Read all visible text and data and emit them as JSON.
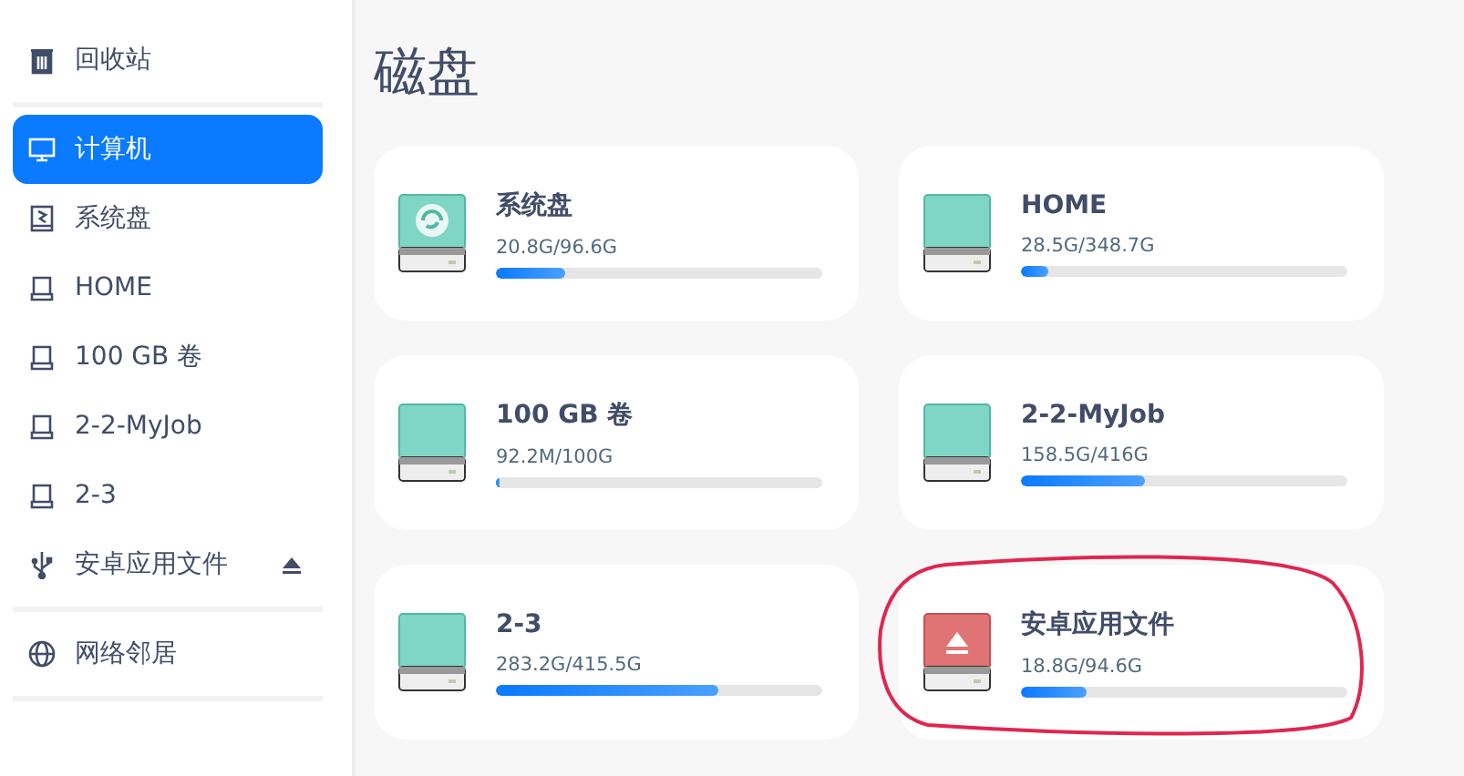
{
  "sidebar": {
    "groups": [
      {
        "items": [
          {
            "kind": "trash",
            "label": "回收站",
            "selected": false,
            "ejectable": false
          }
        ]
      },
      {
        "items": [
          {
            "kind": "computer",
            "label": "计算机",
            "selected": true,
            "ejectable": false
          },
          {
            "kind": "system",
            "label": "系统盘",
            "selected": false,
            "ejectable": false
          },
          {
            "kind": "drive",
            "label": "HOME",
            "selected": false,
            "ejectable": false
          },
          {
            "kind": "drive",
            "label": "100 GB 卷",
            "selected": false,
            "ejectable": false
          },
          {
            "kind": "drive",
            "label": "2-2-MyJob",
            "selected": false,
            "ejectable": false
          },
          {
            "kind": "drive",
            "label": "2-3",
            "selected": false,
            "ejectable": false
          },
          {
            "kind": "usb",
            "label": "安卓应用文件",
            "selected": false,
            "ejectable": true
          }
        ]
      },
      {
        "items": [
          {
            "kind": "network",
            "label": "网络邻居",
            "selected": false,
            "ejectable": false
          }
        ]
      }
    ]
  },
  "main": {
    "title": "磁盘",
    "disks": [
      {
        "kind": "system",
        "name": "系统盘",
        "usage": "20.8G/96.6G",
        "level": 0.215,
        "circled": false
      },
      {
        "kind": "drive",
        "name": "HOME",
        "usage": "28.5G/348.7G",
        "level": 0.082,
        "circled": false
      },
      {
        "kind": "drive",
        "name": "100 GB 卷",
        "usage": "92.2M/100G",
        "level": 0.01,
        "circled": false
      },
      {
        "kind": "drive",
        "name": "2-2-MyJob",
        "usage": "158.5G/416G",
        "level": 0.381,
        "circled": false
      },
      {
        "kind": "drive",
        "name": "2-3",
        "usage": "283.2G/415.5G",
        "level": 0.682,
        "circled": false
      },
      {
        "kind": "removable",
        "name": "安卓应用文件",
        "usage": "18.8G/94.6G",
        "level": 0.199,
        "circled": true
      }
    ]
  }
}
